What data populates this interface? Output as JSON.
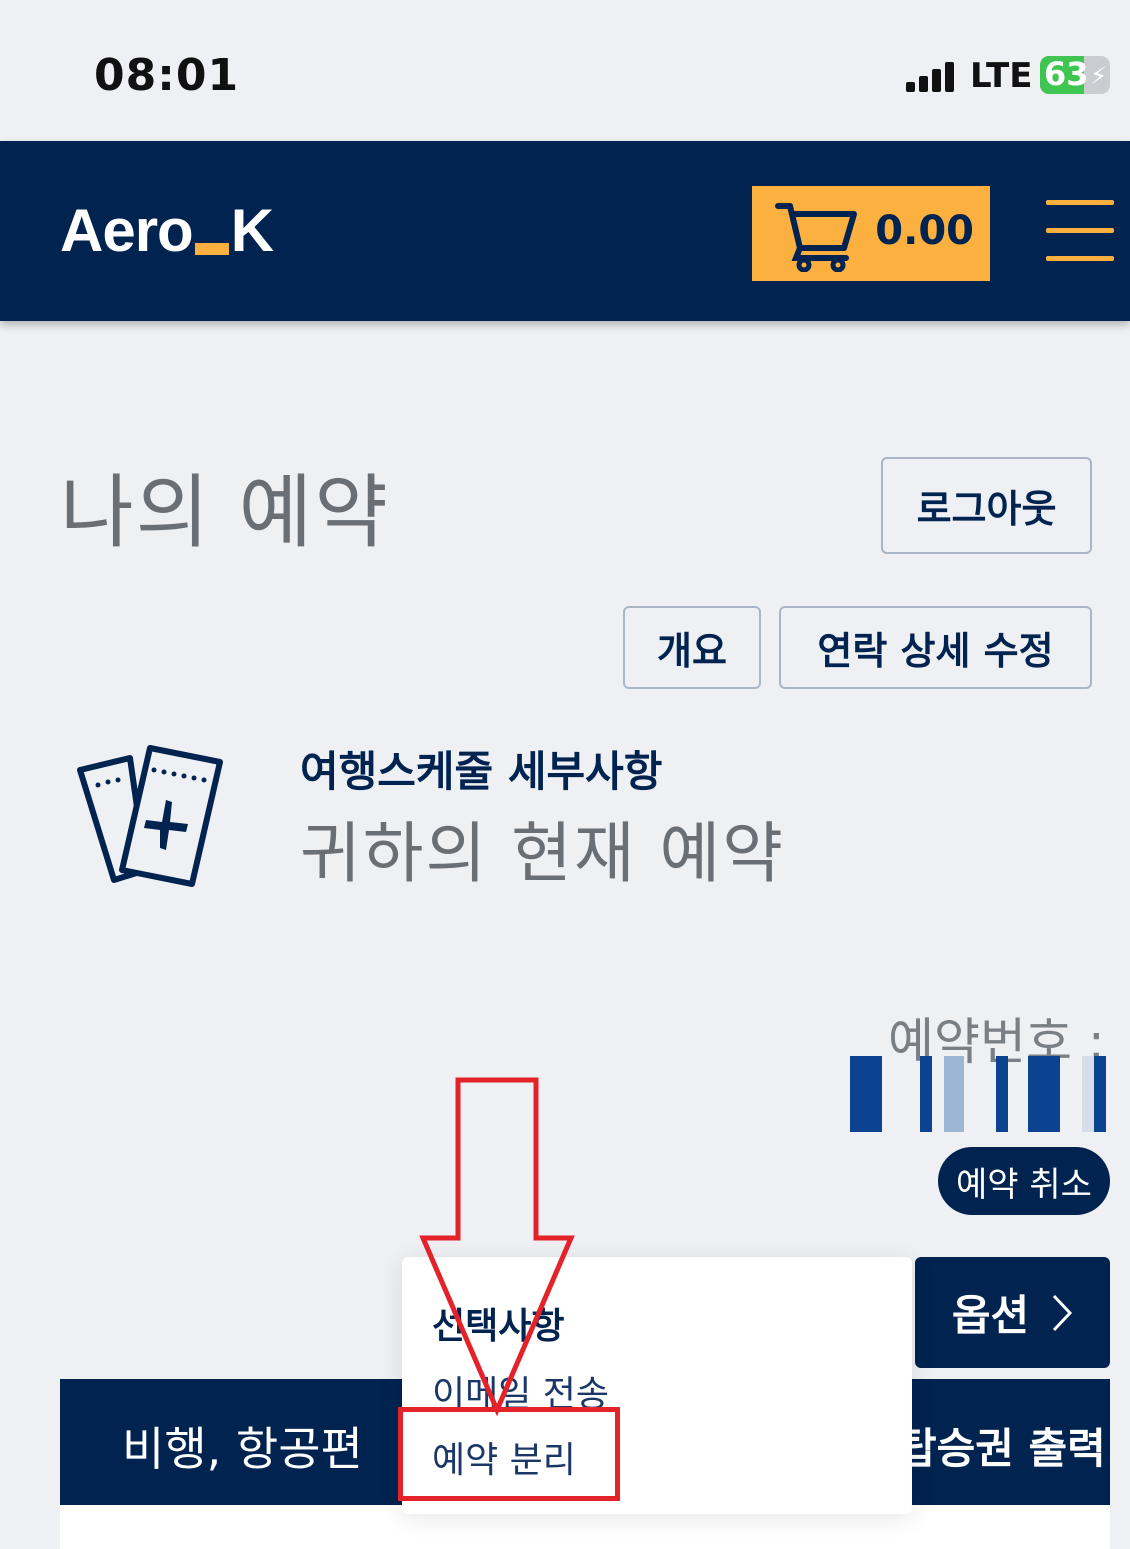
{
  "status_bar": {
    "time": "08:01",
    "network": "LTE",
    "battery": "63",
    "battery_level": 0.63
  },
  "header": {
    "logo_left": "Aero",
    "logo_right": "K",
    "cart_total": "0.00",
    "colors": {
      "navy": "#002350",
      "accent": "#fbb040"
    },
    "icons": {
      "cart": "cart-icon",
      "menu": "hamburger-menu-icon"
    }
  },
  "page": {
    "title": "나의 예약",
    "logout_label": "로그아웃",
    "overview_label": "개요",
    "contact_edit_label": "연락 상세 수정"
  },
  "itinerary": {
    "icon": "tickets-icon",
    "title": "여행스케줄 세부사항",
    "subtitle": "귀하의 현재 예약"
  },
  "booking": {
    "number_label": "예약번호 :",
    "cancel_label": "예약 취소",
    "options_label": "옵션",
    "options_icon": "chevron-right-icon"
  },
  "tabs": {
    "flight_label": "비행, 항공편",
    "print_label": "탑승권 출력"
  },
  "dropdown": {
    "title": "선택사항",
    "items": [
      "이메일 전송",
      "예약 분리"
    ]
  },
  "annotation": {
    "color": "#e4222a"
  }
}
